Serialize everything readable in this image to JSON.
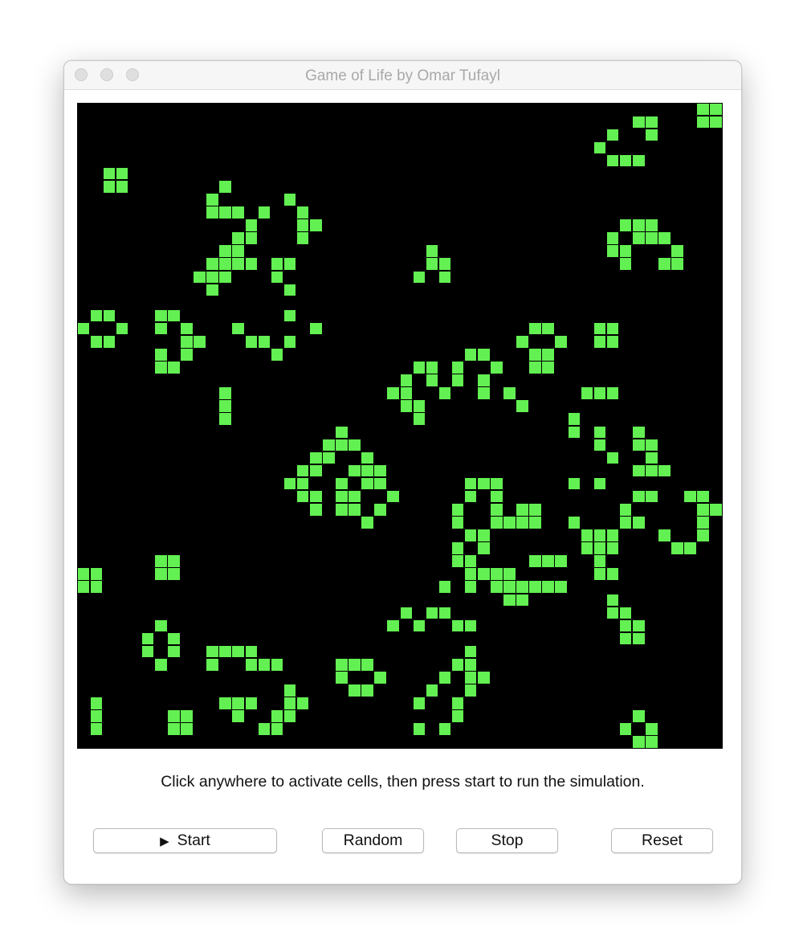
{
  "window": {
    "title": "Game of Life by Omar Tufayl"
  },
  "board": {
    "background": "#000000",
    "cell_color": "#63f052",
    "grid_size": 50,
    "live_cells": [
      [
        0,
        48
      ],
      [
        0,
        49
      ],
      [
        1,
        43
      ],
      [
        1,
        44
      ],
      [
        1,
        48
      ],
      [
        1,
        49
      ],
      [
        2,
        41
      ],
      [
        2,
        44
      ],
      [
        3,
        40
      ],
      [
        4,
        41
      ],
      [
        4,
        42
      ],
      [
        4,
        43
      ],
      [
        5,
        2
      ],
      [
        5,
        3
      ],
      [
        6,
        2
      ],
      [
        6,
        3
      ],
      [
        6,
        11
      ],
      [
        7,
        10
      ],
      [
        7,
        16
      ],
      [
        8,
        10
      ],
      [
        8,
        11
      ],
      [
        8,
        12
      ],
      [
        8,
        14
      ],
      [
        8,
        17
      ],
      [
        9,
        13
      ],
      [
        9,
        17
      ],
      [
        9,
        18
      ],
      [
        9,
        42
      ],
      [
        9,
        43
      ],
      [
        9,
        44
      ],
      [
        10,
        12
      ],
      [
        10,
        13
      ],
      [
        10,
        17
      ],
      [
        10,
        41
      ],
      [
        10,
        43
      ],
      [
        10,
        44
      ],
      [
        10,
        45
      ],
      [
        11,
        11
      ],
      [
        11,
        12
      ],
      [
        11,
        27
      ],
      [
        11,
        41
      ],
      [
        11,
        42
      ],
      [
        11,
        46
      ],
      [
        12,
        10
      ],
      [
        12,
        11
      ],
      [
        12,
        12
      ],
      [
        12,
        13
      ],
      [
        12,
        15
      ],
      [
        12,
        16
      ],
      [
        12,
        27
      ],
      [
        12,
        28
      ],
      [
        12,
        42
      ],
      [
        12,
        45
      ],
      [
        12,
        46
      ],
      [
        13,
        9
      ],
      [
        13,
        10
      ],
      [
        13,
        11
      ],
      [
        13,
        15
      ],
      [
        13,
        26
      ],
      [
        13,
        28
      ],
      [
        14,
        10
      ],
      [
        14,
        16
      ],
      [
        16,
        1
      ],
      [
        16,
        2
      ],
      [
        16,
        6
      ],
      [
        16,
        7
      ],
      [
        16,
        16
      ],
      [
        17,
        0
      ],
      [
        17,
        3
      ],
      [
        17,
        6
      ],
      [
        17,
        8
      ],
      [
        17,
        12
      ],
      [
        17,
        18
      ],
      [
        17,
        35
      ],
      [
        17,
        36
      ],
      [
        17,
        40
      ],
      [
        17,
        41
      ],
      [
        18,
        1
      ],
      [
        18,
        2
      ],
      [
        18,
        8
      ],
      [
        18,
        9
      ],
      [
        18,
        13
      ],
      [
        18,
        14
      ],
      [
        18,
        16
      ],
      [
        18,
        34
      ],
      [
        18,
        37
      ],
      [
        18,
        40
      ],
      [
        18,
        41
      ],
      [
        19,
        6
      ],
      [
        19,
        8
      ],
      [
        19,
        15
      ],
      [
        19,
        30
      ],
      [
        19,
        31
      ],
      [
        19,
        35
      ],
      [
        19,
        36
      ],
      [
        20,
        6
      ],
      [
        20,
        7
      ],
      [
        20,
        26
      ],
      [
        20,
        27
      ],
      [
        20,
        29
      ],
      [
        20,
        32
      ],
      [
        20,
        35
      ],
      [
        20,
        36
      ],
      [
        21,
        25
      ],
      [
        21,
        27
      ],
      [
        21,
        29
      ],
      [
        21,
        31
      ],
      [
        22,
        11
      ],
      [
        22,
        24
      ],
      [
        22,
        25
      ],
      [
        22,
        28
      ],
      [
        22,
        31
      ],
      [
        22,
        33
      ],
      [
        22,
        39
      ],
      [
        22,
        40
      ],
      [
        22,
        41
      ],
      [
        23,
        11
      ],
      [
        23,
        25
      ],
      [
        23,
        26
      ],
      [
        23,
        34
      ],
      [
        24,
        11
      ],
      [
        24,
        26
      ],
      [
        24,
        38
      ],
      [
        25,
        20
      ],
      [
        25,
        38
      ],
      [
        25,
        40
      ],
      [
        25,
        43
      ],
      [
        26,
        19
      ],
      [
        26,
        20
      ],
      [
        26,
        21
      ],
      [
        26,
        40
      ],
      [
        26,
        43
      ],
      [
        26,
        44
      ],
      [
        27,
        18
      ],
      [
        27,
        19
      ],
      [
        27,
        22
      ],
      [
        27,
        41
      ],
      [
        27,
        44
      ],
      [
        28,
        17
      ],
      [
        28,
        18
      ],
      [
        28,
        21
      ],
      [
        28,
        22
      ],
      [
        28,
        23
      ],
      [
        28,
        43
      ],
      [
        28,
        44
      ],
      [
        28,
        45
      ],
      [
        29,
        16
      ],
      [
        29,
        17
      ],
      [
        29,
        20
      ],
      [
        29,
        22
      ],
      [
        29,
        23
      ],
      [
        29,
        30
      ],
      [
        29,
        31
      ],
      [
        29,
        32
      ],
      [
        29,
        38
      ],
      [
        29,
        40
      ],
      [
        30,
        17
      ],
      [
        30,
        18
      ],
      [
        30,
        20
      ],
      [
        30,
        21
      ],
      [
        30,
        24
      ],
      [
        30,
        30
      ],
      [
        30,
        32
      ],
      [
        30,
        43
      ],
      [
        30,
        44
      ],
      [
        30,
        47
      ],
      [
        30,
        48
      ],
      [
        31,
        18
      ],
      [
        31,
        20
      ],
      [
        31,
        21
      ],
      [
        31,
        23
      ],
      [
        31,
        29
      ],
      [
        31,
        32
      ],
      [
        31,
        34
      ],
      [
        31,
        35
      ],
      [
        31,
        42
      ],
      [
        31,
        48
      ],
      [
        31,
        49
      ],
      [
        32,
        22
      ],
      [
        32,
        29
      ],
      [
        32,
        32
      ],
      [
        32,
        33
      ],
      [
        32,
        34
      ],
      [
        32,
        35
      ],
      [
        32,
        38
      ],
      [
        32,
        42
      ],
      [
        32,
        43
      ],
      [
        32,
        48
      ],
      [
        33,
        30
      ],
      [
        33,
        31
      ],
      [
        33,
        39
      ],
      [
        33,
        40
      ],
      [
        33,
        41
      ],
      [
        33,
        45
      ],
      [
        33,
        48
      ],
      [
        34,
        29
      ],
      [
        34,
        31
      ],
      [
        34,
        39
      ],
      [
        34,
        40
      ],
      [
        34,
        41
      ],
      [
        34,
        46
      ],
      [
        34,
        47
      ],
      [
        35,
        6
      ],
      [
        35,
        7
      ],
      [
        35,
        29
      ],
      [
        35,
        30
      ],
      [
        35,
        35
      ],
      [
        35,
        36
      ],
      [
        35,
        37
      ],
      [
        35,
        40
      ],
      [
        36,
        0
      ],
      [
        36,
        1
      ],
      [
        36,
        6
      ],
      [
        36,
        7
      ],
      [
        36,
        30
      ],
      [
        36,
        31
      ],
      [
        36,
        32
      ],
      [
        36,
        33
      ],
      [
        36,
        40
      ],
      [
        36,
        41
      ],
      [
        37,
        0
      ],
      [
        37,
        1
      ],
      [
        37,
        28
      ],
      [
        37,
        30
      ],
      [
        37,
        32
      ],
      [
        37,
        33
      ],
      [
        37,
        34
      ],
      [
        37,
        35
      ],
      [
        37,
        36
      ],
      [
        37,
        37
      ],
      [
        38,
        33
      ],
      [
        38,
        34
      ],
      [
        38,
        41
      ],
      [
        39,
        25
      ],
      [
        39,
        27
      ],
      [
        39,
        28
      ],
      [
        39,
        41
      ],
      [
        39,
        42
      ],
      [
        40,
        6
      ],
      [
        40,
        24
      ],
      [
        40,
        26
      ],
      [
        40,
        29
      ],
      [
        40,
        30
      ],
      [
        40,
        42
      ],
      [
        40,
        43
      ],
      [
        41,
        5
      ],
      [
        41,
        7
      ],
      [
        41,
        42
      ],
      [
        41,
        43
      ],
      [
        42,
        5
      ],
      [
        42,
        7
      ],
      [
        42,
        10
      ],
      [
        42,
        11
      ],
      [
        42,
        12
      ],
      [
        42,
        13
      ],
      [
        42,
        30
      ],
      [
        43,
        6
      ],
      [
        43,
        10
      ],
      [
        43,
        13
      ],
      [
        43,
        14
      ],
      [
        43,
        15
      ],
      [
        43,
        20
      ],
      [
        43,
        21
      ],
      [
        43,
        22
      ],
      [
        43,
        29
      ],
      [
        43,
        30
      ],
      [
        44,
        20
      ],
      [
        44,
        23
      ],
      [
        44,
        28
      ],
      [
        44,
        30
      ],
      [
        44,
        31
      ],
      [
        45,
        16
      ],
      [
        45,
        21
      ],
      [
        45,
        22
      ],
      [
        45,
        27
      ],
      [
        45,
        30
      ],
      [
        46,
        1
      ],
      [
        46,
        11
      ],
      [
        46,
        12
      ],
      [
        46,
        13
      ],
      [
        46,
        16
      ],
      [
        46,
        17
      ],
      [
        46,
        26
      ],
      [
        46,
        29
      ],
      [
        47,
        1
      ],
      [
        47,
        7
      ],
      [
        47,
        8
      ],
      [
        47,
        12
      ],
      [
        47,
        15
      ],
      [
        47,
        16
      ],
      [
        47,
        29
      ],
      [
        47,
        43
      ],
      [
        48,
        1
      ],
      [
        48,
        7
      ],
      [
        48,
        8
      ],
      [
        48,
        14
      ],
      [
        48,
        15
      ],
      [
        48,
        26
      ],
      [
        48,
        28
      ],
      [
        48,
        42
      ],
      [
        48,
        44
      ],
      [
        49,
        43
      ],
      [
        49,
        44
      ]
    ]
  },
  "instructions": "Click anywhere to activate cells, then press start to run the simulation.",
  "buttons": {
    "start": {
      "label": "Start",
      "icon": "play-icon"
    },
    "random": {
      "label": "Random"
    },
    "stop": {
      "label": "Stop"
    },
    "reset": {
      "label": "Reset"
    }
  }
}
